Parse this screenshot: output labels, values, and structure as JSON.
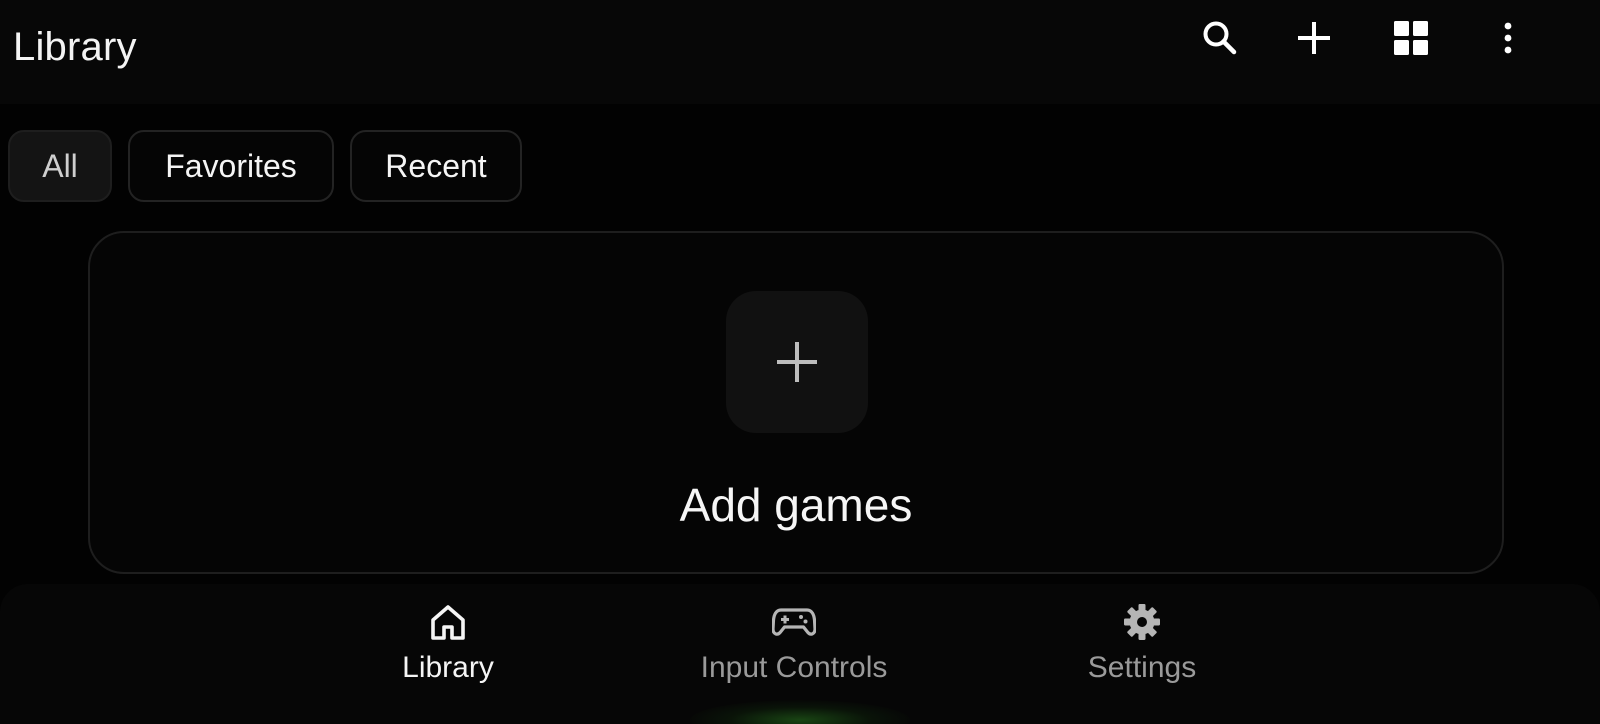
{
  "header": {
    "title": "Library",
    "actions": [
      {
        "icon": "search-icon"
      },
      {
        "icon": "plus-icon"
      },
      {
        "icon": "grid-view-icon"
      },
      {
        "icon": "more-vertical-icon"
      }
    ]
  },
  "filters": {
    "chips": [
      {
        "label": "All",
        "active": true
      },
      {
        "label": "Favorites",
        "active": false
      },
      {
        "label": "Recent",
        "active": false
      }
    ]
  },
  "empty_state": {
    "icon": "plus-icon",
    "label": "Add games"
  },
  "bottom_nav": {
    "items": [
      {
        "label": "Library",
        "icon": "home-icon",
        "active": true
      },
      {
        "label": "Input Controls",
        "icon": "gamepad-icon",
        "active": false
      },
      {
        "label": "Settings",
        "icon": "gear-icon",
        "active": false
      }
    ]
  },
  "colors": {
    "background": "#020202",
    "active_text": "#f5f5f5",
    "inactive_text": "#9a9a9a",
    "accent_glow": "#28781e"
  }
}
